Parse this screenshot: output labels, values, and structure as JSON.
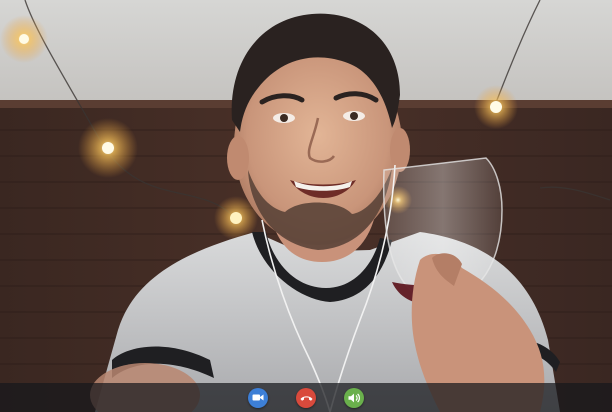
{
  "video_call": {
    "feed": {
      "description_icon": "remote-participant-video"
    },
    "controls": [
      {
        "id": "video",
        "icon": "video-camera-icon",
        "color": "#3d7fd6"
      },
      {
        "id": "hangup",
        "icon": "phone-hangup-icon",
        "color": "#d94a3c"
      },
      {
        "id": "audio",
        "icon": "speaker-icon",
        "color": "#6ab04c"
      }
    ]
  }
}
